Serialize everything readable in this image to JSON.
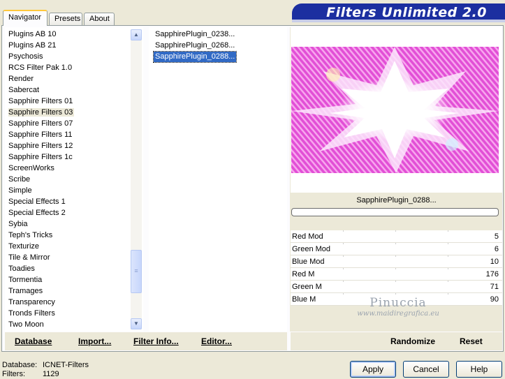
{
  "tabs": [
    {
      "label": "Navigator"
    },
    {
      "label": "Presets"
    },
    {
      "label": "About"
    }
  ],
  "brand": {
    "title": "Filters Unlimited 2.0",
    "color": "#1c2fa0"
  },
  "categories": {
    "items": [
      "Plugins AB 10",
      "Plugins AB 21",
      "Psychosis",
      "RCS Filter Pak 1.0",
      "Render",
      "Sabercat",
      "Sapphire Filters 01",
      "Sapphire Filters 03",
      "Sapphire Filters 07",
      "Sapphire Filters 11",
      "Sapphire Filters 12",
      "Sapphire Filters 1c",
      "ScreenWorks",
      "Scribe",
      "Simple",
      "Special Effects 1",
      "Special Effects 2",
      "Sybia",
      "Teph's Tricks",
      "Texturize",
      "Tile & Mirror",
      "Toadies",
      "Tormentia",
      "Tramages",
      "Transparency",
      "Tronds Filters",
      "Two Moon"
    ],
    "selected": "Sapphire Filters 03"
  },
  "filters": {
    "items": [
      "SapphirePlugin_0238...",
      "SapphirePlugin_0268...",
      "SapphirePlugin_0288..."
    ],
    "selected": "SapphirePlugin_0288..."
  },
  "preview": {
    "label": "SapphirePlugin_0288..."
  },
  "params": [
    {
      "name": "Red Mod",
      "value": "5"
    },
    {
      "name": "Green Mod",
      "value": "6"
    },
    {
      "name": "Blue Mod",
      "value": "10"
    },
    {
      "name": "Red M",
      "value": "176"
    },
    {
      "name": "Green M",
      "value": "71"
    },
    {
      "name": "Blue M",
      "value": "90"
    }
  ],
  "watermark": {
    "name": "Pinuccia",
    "url": "www.maidiregrafica.eu"
  },
  "buttons": {
    "database": "Database",
    "import": "Import...",
    "filter_info": "Filter Info...",
    "editor": "Editor...",
    "randomize": "Randomize",
    "reset": "Reset",
    "apply": "Apply",
    "cancel": "Cancel",
    "help": "Help"
  },
  "footer": {
    "database_label": "Database:",
    "database_value": "ICNET-Filters",
    "filters_label": "Filters:",
    "filters_value": "1129"
  },
  "colors": {
    "selection": "#316ac5",
    "panel": "#ece9d8",
    "preview_pink": "#e24fd6"
  }
}
